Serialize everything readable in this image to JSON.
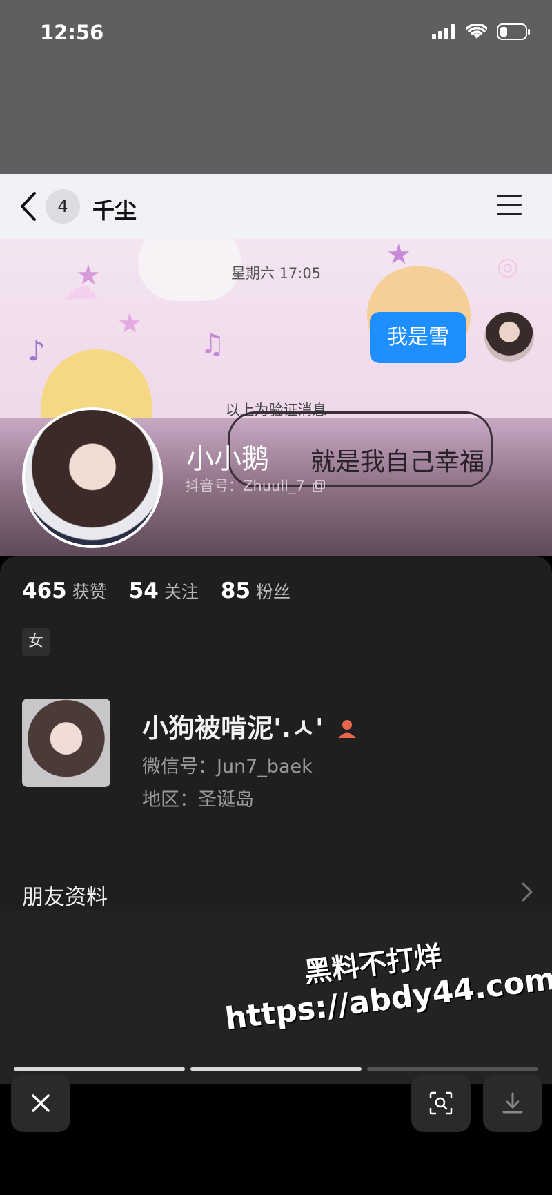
{
  "status_bar": {
    "time": "12:56"
  },
  "chat_header": {
    "unread_count": "4",
    "title": "千尘"
  },
  "chat": {
    "timestamp": "星期六 17:05",
    "message": "我是雪",
    "verify_note": "以上为验证消息"
  },
  "profile": {
    "name": "小小鹅",
    "douyin_id": "抖音号：Zhuull_7",
    "bg_text": "就是我自己幸福",
    "stats": [
      {
        "value": "465",
        "label": "获赞"
      },
      {
        "value": "54",
        "label": "关注"
      },
      {
        "value": "85",
        "label": "粉丝"
      }
    ],
    "gender": "女"
  },
  "wechat_card": {
    "name": "小狗被啃泥'.ㅅ'",
    "wechat_id": "微信号：Jun7_baek",
    "region": "地区：圣诞岛"
  },
  "friend_info": {
    "label": "朋友资料"
  },
  "watermark": {
    "line1": "黑料不打烊",
    "line2": "https://abdy44.com"
  },
  "viewer": {
    "progress_segments": [
      1,
      1,
      0
    ],
    "colors": {
      "progress_active": "#d9d9d9",
      "progress_inactive": "#555555",
      "bubble": "#1f8fff"
    }
  },
  "icons": [
    "back-icon",
    "menu-icon",
    "copy-icon",
    "person-icon",
    "chevron-right-icon",
    "close-icon",
    "scan-icon",
    "download-icon",
    "signal-icon",
    "wifi-icon",
    "battery-icon"
  ]
}
